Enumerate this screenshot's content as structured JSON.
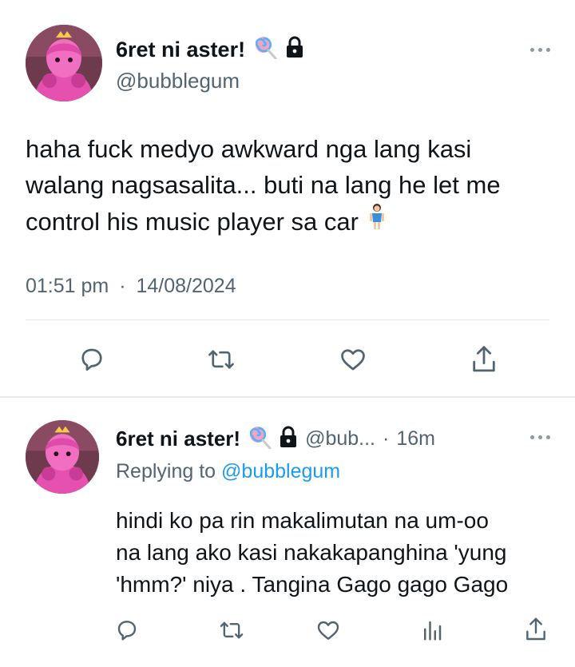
{
  "main_tweet": {
    "display_name": "6ret ni aster!",
    "name_icons": [
      "lollipop-icon",
      "lock-icon"
    ],
    "handle": "@bubblegum",
    "text_lines": [
      "haha fuck medyo awkward nga lang kasi",
      "walang nagsasalita... buti na lang he let me",
      "control his music player sa car"
    ],
    "emoji": "woman-standing-icon",
    "time": "01:51 pm",
    "separator": "·",
    "date": "14/08/2024",
    "actions": [
      "reply-icon",
      "retweet-icon",
      "like-icon",
      "share-icon"
    ]
  },
  "reply_tweet": {
    "display_name": "6ret ni aster!",
    "name_icons": [
      "lollipop-icon",
      "lock-icon"
    ],
    "handle": "@bub...",
    "separator": "·",
    "age": "16m",
    "replying_prefix": "Replying to",
    "replying_handle": "@bubblegum",
    "text_lines": [
      "hindi ko pa rin makalimutan na um-oo",
      "na lang ako kasi nakakapanghina 'yung",
      "'hmm?' niya . Tangina Gago gago Gago"
    ],
    "actions": [
      "reply-icon",
      "retweet-icon",
      "like-icon",
      "views-icon",
      "share-icon"
    ]
  },
  "colors": {
    "text": "#0f1419",
    "secondary": "#536471",
    "link": "#1d9bf0",
    "divider": "#e6e9eb",
    "avatar_pink": "#e94aa8"
  }
}
